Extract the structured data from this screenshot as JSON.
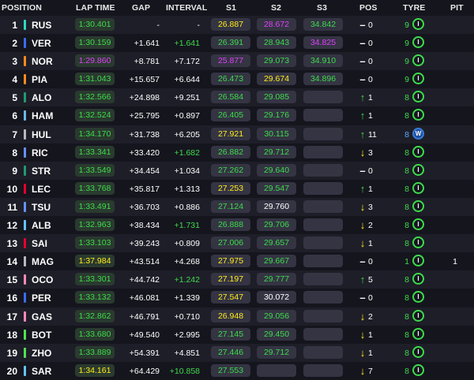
{
  "headers": {
    "position": "POSITION",
    "lap_time": "LAP TIME",
    "gap": "GAP",
    "interval": "INTERVAL",
    "s1": "S1",
    "s2": "S2",
    "s3": "S3",
    "pos": "POS",
    "tyre": "TYRE",
    "pit": "PIT"
  },
  "colors": {
    "green": "#3ddc4a",
    "yellow": "#ffec1a",
    "purple": "#e040fb",
    "white": "#ffffff"
  },
  "rows": [
    {
      "pos": "1",
      "team_color": "#2fd7c6",
      "driver": "RUS",
      "lap": "1:30.401",
      "lap_c": "green",
      "gap": "-",
      "gap_c": "white",
      "int": "-",
      "int_c": "white",
      "s1": "26.887",
      "s1_c": "yellow",
      "s2": "28.672",
      "s2_c": "purple",
      "s3": "34.842",
      "s3_c": "green",
      "arrow": "–",
      "arrow_c": "white",
      "pchg": "0",
      "age": "9",
      "age_c": "green",
      "tyre": "I",
      "tyre_c": "#3ddc4a",
      "pit": ""
    },
    {
      "pos": "2",
      "team_color": "#3a6df0",
      "driver": "VER",
      "lap": "1:30.159",
      "lap_c": "green",
      "gap": "+1.641",
      "gap_c": "white",
      "int": "+1.641",
      "int_c": "green",
      "s1": "26.391",
      "s1_c": "green",
      "s2": "28.943",
      "s2_c": "green",
      "s3": "34.825",
      "s3_c": "purple",
      "arrow": "–",
      "arrow_c": "white",
      "pchg": "0",
      "age": "9",
      "age_c": "green",
      "tyre": "I",
      "tyre_c": "#3ddc4a",
      "pit": ""
    },
    {
      "pos": "3",
      "team_color": "#ff8a1c",
      "driver": "NOR",
      "lap": "1:29.860",
      "lap_c": "purple",
      "gap": "+8.781",
      "gap_c": "white",
      "int": "+7.172",
      "int_c": "white",
      "s1": "25.877",
      "s1_c": "purple",
      "s2": "29.073",
      "s2_c": "green",
      "s3": "34.910",
      "s3_c": "green",
      "arrow": "–",
      "arrow_c": "white",
      "pchg": "0",
      "age": "9",
      "age_c": "green",
      "tyre": "I",
      "tyre_c": "#3ddc4a",
      "pit": ""
    },
    {
      "pos": "4",
      "team_color": "#ff8a1c",
      "driver": "PIA",
      "lap": "1:31.043",
      "lap_c": "green",
      "gap": "+15.657",
      "gap_c": "white",
      "int": "+6.644",
      "int_c": "white",
      "s1": "26.473",
      "s1_c": "green",
      "s2": "29.674",
      "s2_c": "yellow",
      "s3": "34.896",
      "s3_c": "green",
      "arrow": "–",
      "arrow_c": "white",
      "pchg": "0",
      "age": "9",
      "age_c": "green",
      "tyre": "I",
      "tyre_c": "#3ddc4a",
      "pit": ""
    },
    {
      "pos": "5",
      "team_color": "#229971",
      "driver": "ALO",
      "lap": "1:32.566",
      "lap_c": "green",
      "gap": "+24.898",
      "gap_c": "white",
      "int": "+9.251",
      "int_c": "white",
      "s1": "26.584",
      "s1_c": "green",
      "s2": "29.085",
      "s2_c": "green",
      "s3": "",
      "s3_c": "white",
      "arrow": "↑",
      "arrow_c": "green",
      "pchg": "1",
      "age": "8",
      "age_c": "green",
      "tyre": "I",
      "tyre_c": "#3ddc4a",
      "pit": ""
    },
    {
      "pos": "6",
      "team_color": "#6ab8e8",
      "driver": "HAM",
      "lap": "1:32.524",
      "lap_c": "green",
      "gap": "+25.795",
      "gap_c": "white",
      "int": "+0.897",
      "int_c": "white",
      "s1": "26.405",
      "s1_c": "green",
      "s2": "29.176",
      "s2_c": "green",
      "s3": "",
      "s3_c": "white",
      "arrow": "↑",
      "arrow_c": "green",
      "pchg": "1",
      "age": "8",
      "age_c": "green",
      "tyre": "I",
      "tyre_c": "#3ddc4a",
      "pit": ""
    },
    {
      "pos": "7",
      "team_color": "#b6babd",
      "driver": "HUL",
      "lap": "1:34.170",
      "lap_c": "green",
      "gap": "+31.738",
      "gap_c": "white",
      "int": "+6.205",
      "int_c": "white",
      "s1": "27.921",
      "s1_c": "yellow",
      "s2": "30.115",
      "s2_c": "green",
      "s3": "",
      "s3_c": "white",
      "arrow": "↑",
      "arrow_c": "green",
      "pchg": "11",
      "age": "8",
      "age_c": "blue",
      "tyre": "W",
      "tyre_c": "#3a7bd5",
      "pit": ""
    },
    {
      "pos": "8",
      "team_color": "#6692ff",
      "driver": "RIC",
      "lap": "1:33.341",
      "lap_c": "green",
      "gap": "+33.420",
      "gap_c": "white",
      "int": "+1.682",
      "int_c": "green",
      "s1": "26.882",
      "s1_c": "green",
      "s2": "29.712",
      "s2_c": "green",
      "s3": "",
      "s3_c": "white",
      "arrow": "↓",
      "arrow_c": "yellow",
      "pchg": "3",
      "age": "8",
      "age_c": "green",
      "tyre": "I",
      "tyre_c": "#3ddc4a",
      "pit": ""
    },
    {
      "pos": "9",
      "team_color": "#229971",
      "driver": "STR",
      "lap": "1:33.549",
      "lap_c": "green",
      "gap": "+34.454",
      "gap_c": "white",
      "int": "+1.034",
      "int_c": "white",
      "s1": "27.262",
      "s1_c": "green",
      "s2": "29.640",
      "s2_c": "green",
      "s3": "",
      "s3_c": "white",
      "arrow": "–",
      "arrow_c": "white",
      "pchg": "0",
      "age": "8",
      "age_c": "green",
      "tyre": "I",
      "tyre_c": "#3ddc4a",
      "pit": ""
    },
    {
      "pos": "10",
      "team_color": "#e8002d",
      "driver": "LEC",
      "lap": "1:33.768",
      "lap_c": "green",
      "gap": "+35.817",
      "gap_c": "white",
      "int": "+1.313",
      "int_c": "white",
      "s1": "27.253",
      "s1_c": "yellow",
      "s2": "29.547",
      "s2_c": "green",
      "s3": "",
      "s3_c": "white",
      "arrow": "↑",
      "arrow_c": "green",
      "pchg": "1",
      "age": "8",
      "age_c": "green",
      "tyre": "I",
      "tyre_c": "#3ddc4a",
      "pit": ""
    },
    {
      "pos": "11",
      "team_color": "#6692ff",
      "driver": "TSU",
      "lap": "1:33.491",
      "lap_c": "green",
      "gap": "+36.703",
      "gap_c": "white",
      "int": "+0.886",
      "int_c": "white",
      "s1": "27.124",
      "s1_c": "green",
      "s2": "29.760",
      "s2_c": "white",
      "s3": "",
      "s3_c": "white",
      "arrow": "↓",
      "arrow_c": "yellow",
      "pchg": "3",
      "age": "8",
      "age_c": "green",
      "tyre": "I",
      "tyre_c": "#3ddc4a",
      "pit": ""
    },
    {
      "pos": "12",
      "team_color": "#64c4ff",
      "driver": "ALB",
      "lap": "1:32.963",
      "lap_c": "green",
      "gap": "+38.434",
      "gap_c": "white",
      "int": "+1.731",
      "int_c": "green",
      "s1": "26.888",
      "s1_c": "green",
      "s2": "29.706",
      "s2_c": "green",
      "s3": "",
      "s3_c": "white",
      "arrow": "↓",
      "arrow_c": "yellow",
      "pchg": "2",
      "age": "8",
      "age_c": "green",
      "tyre": "I",
      "tyre_c": "#3ddc4a",
      "pit": ""
    },
    {
      "pos": "13",
      "team_color": "#e8002d",
      "driver": "SAI",
      "lap": "1:33.103",
      "lap_c": "green",
      "gap": "+39.243",
      "gap_c": "white",
      "int": "+0.809",
      "int_c": "white",
      "s1": "27.006",
      "s1_c": "green",
      "s2": "29.657",
      "s2_c": "green",
      "s3": "",
      "s3_c": "white",
      "arrow": "↓",
      "arrow_c": "yellow",
      "pchg": "1",
      "age": "8",
      "age_c": "green",
      "tyre": "I",
      "tyre_c": "#3ddc4a",
      "pit": ""
    },
    {
      "pos": "14",
      "team_color": "#b6babd",
      "driver": "MAG",
      "lap": "1:37.984",
      "lap_c": "yellow",
      "gap": "+43.514",
      "gap_c": "white",
      "int": "+4.268",
      "int_c": "white",
      "s1": "27.975",
      "s1_c": "yellow",
      "s2": "29.667",
      "s2_c": "green",
      "s3": "",
      "s3_c": "white",
      "arrow": "–",
      "arrow_c": "white",
      "pchg": "0",
      "age": "1",
      "age_c": "green",
      "tyre": "I",
      "tyre_c": "#3ddc4a",
      "pit": "1"
    },
    {
      "pos": "15",
      "team_color": "#ff87bc",
      "driver": "OCO",
      "lap": "1:33.301",
      "lap_c": "green",
      "gap": "+44.742",
      "gap_c": "white",
      "int": "+1.242",
      "int_c": "green",
      "s1": "27.197",
      "s1_c": "yellow",
      "s2": "29.777",
      "s2_c": "green",
      "s3": "",
      "s3_c": "white",
      "arrow": "↑",
      "arrow_c": "green",
      "pchg": "5",
      "age": "8",
      "age_c": "green",
      "tyre": "I",
      "tyre_c": "#3ddc4a",
      "pit": ""
    },
    {
      "pos": "16",
      "team_color": "#3a6df0",
      "driver": "PER",
      "lap": "1:33.132",
      "lap_c": "green",
      "gap": "+46.081",
      "gap_c": "white",
      "int": "+1.339",
      "int_c": "white",
      "s1": "27.547",
      "s1_c": "yellow",
      "s2": "30.072",
      "s2_c": "white",
      "s3": "",
      "s3_c": "white",
      "arrow": "–",
      "arrow_c": "white",
      "pchg": "0",
      "age": "8",
      "age_c": "green",
      "tyre": "I",
      "tyre_c": "#3ddc4a",
      "pit": ""
    },
    {
      "pos": "17",
      "team_color": "#ff87bc",
      "driver": "GAS",
      "lap": "1:32.862",
      "lap_c": "green",
      "gap": "+46.791",
      "gap_c": "white",
      "int": "+0.710",
      "int_c": "white",
      "s1": "26.948",
      "s1_c": "yellow",
      "s2": "29.056",
      "s2_c": "green",
      "s3": "",
      "s3_c": "white",
      "arrow": "↓",
      "arrow_c": "yellow",
      "pchg": "2",
      "age": "8",
      "age_c": "green",
      "tyre": "I",
      "tyre_c": "#3ddc4a",
      "pit": ""
    },
    {
      "pos": "18",
      "team_color": "#52e252",
      "driver": "BOT",
      "lap": "1:33.680",
      "lap_c": "green",
      "gap": "+49.540",
      "gap_c": "white",
      "int": "+2.995",
      "int_c": "white",
      "s1": "27.145",
      "s1_c": "green",
      "s2": "29.450",
      "s2_c": "green",
      "s3": "",
      "s3_c": "white",
      "arrow": "↓",
      "arrow_c": "yellow",
      "pchg": "1",
      "age": "8",
      "age_c": "green",
      "tyre": "I",
      "tyre_c": "#3ddc4a",
      "pit": ""
    },
    {
      "pos": "19",
      "team_color": "#52e252",
      "driver": "ZHO",
      "lap": "1:33.889",
      "lap_c": "green",
      "gap": "+54.391",
      "gap_c": "white",
      "int": "+4.851",
      "int_c": "white",
      "s1": "27.446",
      "s1_c": "green",
      "s2": "29.712",
      "s2_c": "green",
      "s3": "",
      "s3_c": "white",
      "arrow": "↓",
      "arrow_c": "yellow",
      "pchg": "1",
      "age": "8",
      "age_c": "green",
      "tyre": "I",
      "tyre_c": "#3ddc4a",
      "pit": ""
    },
    {
      "pos": "20",
      "team_color": "#64c4ff",
      "driver": "SAR",
      "lap": "1:34.161",
      "lap_c": "yellow",
      "gap": "+64.429",
      "gap_c": "white",
      "int": "+10.858",
      "int_c": "green",
      "s1": "27.553",
      "s1_c": "green",
      "s2": "",
      "s2_c": "white",
      "s3": "",
      "s3_c": "white",
      "arrow": "↓",
      "arrow_c": "yellow",
      "pchg": "7",
      "age": "8",
      "age_c": "green",
      "tyre": "I",
      "tyre_c": "#3ddc4a",
      "pit": ""
    }
  ]
}
